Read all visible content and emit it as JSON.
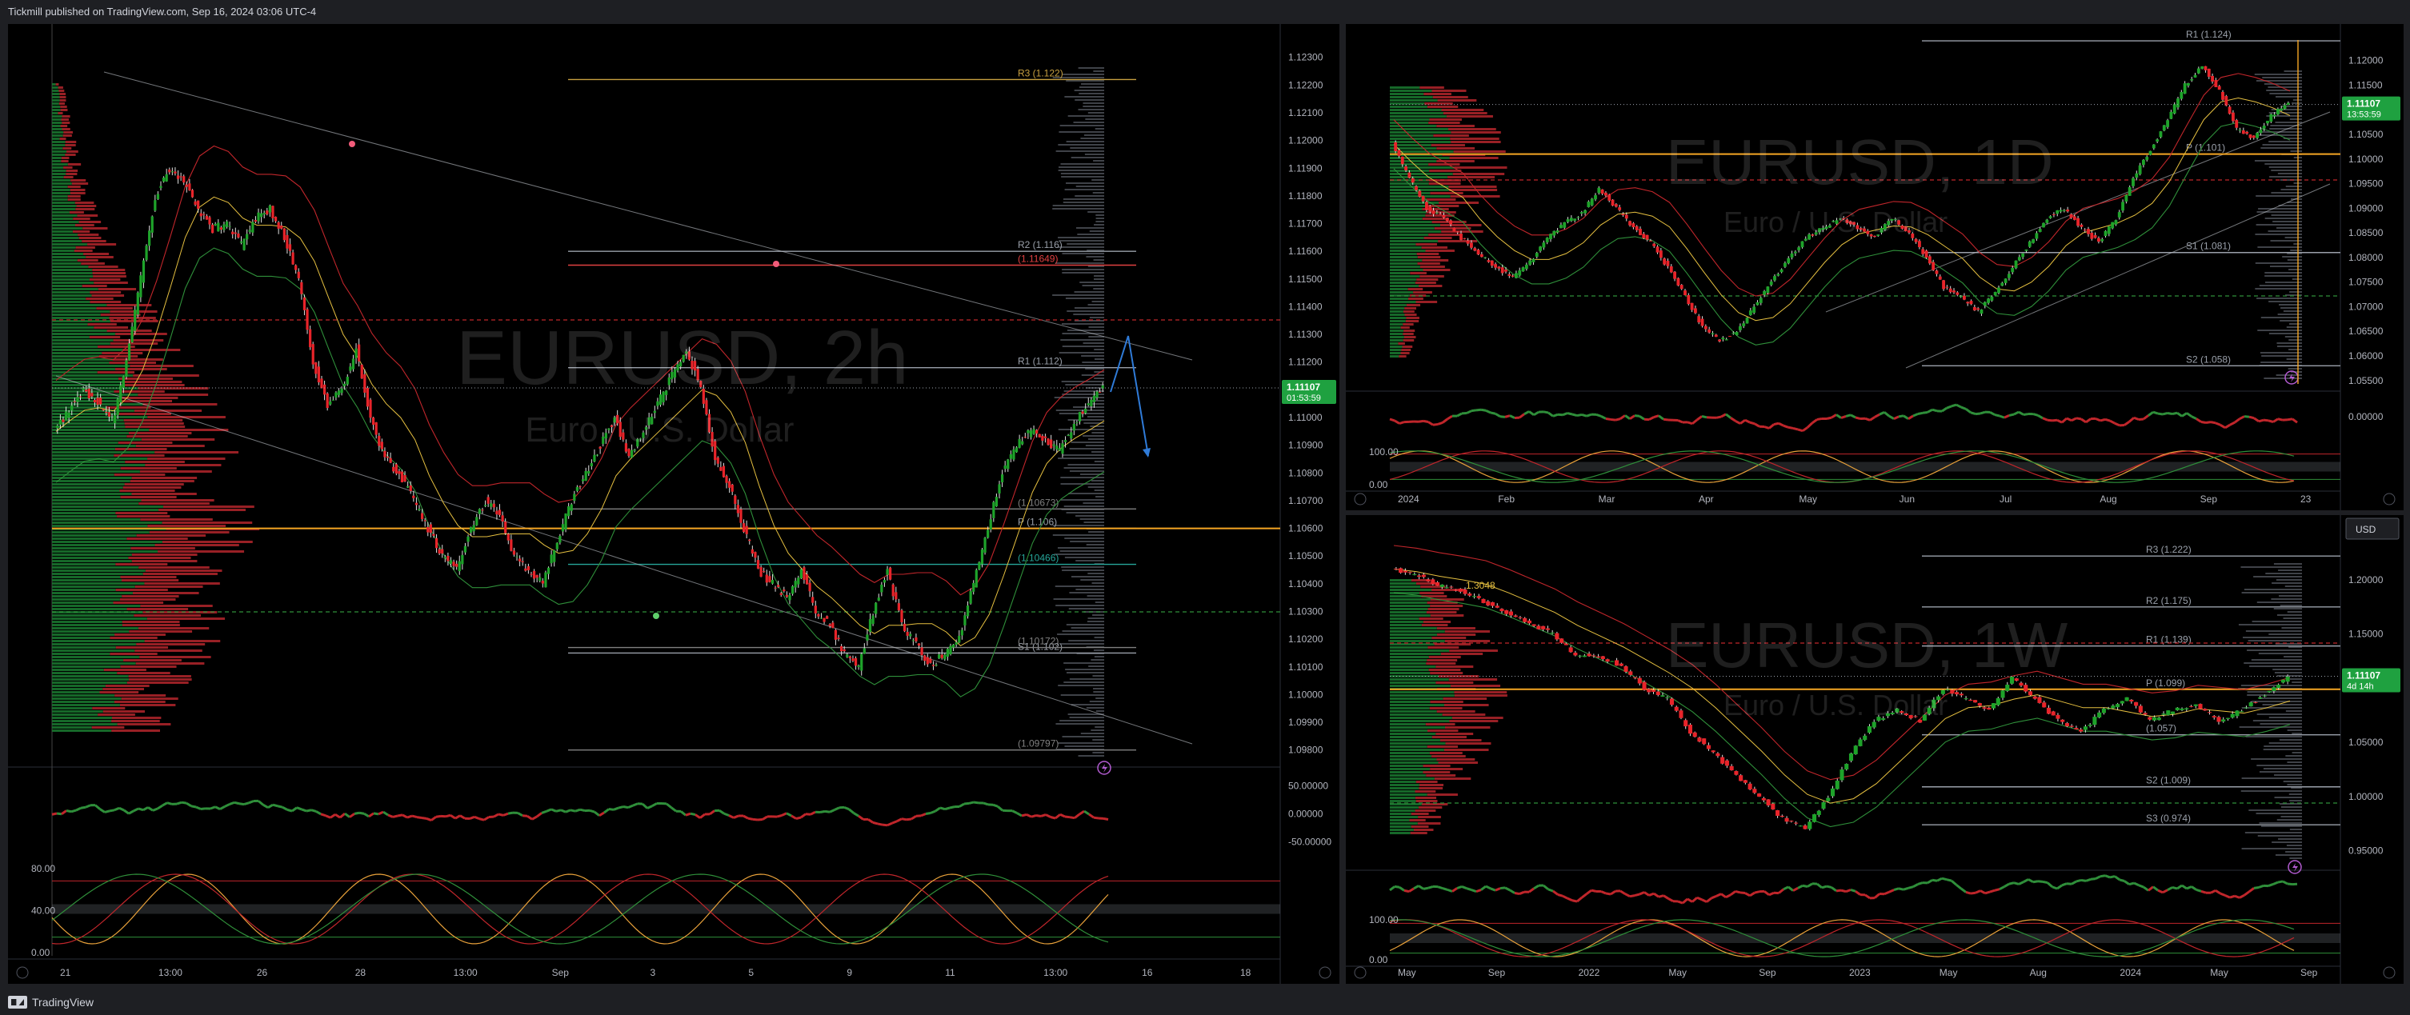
{
  "header": {
    "publish_line": "Tickmill published on TradingView.com, Sep 16, 2024 03:06 UTC-4"
  },
  "footer": {
    "brand": "TradingView"
  },
  "chart_data": [
    {
      "type": "candlestick",
      "symbol_watermark": "EURUSD, 2h",
      "subtitle_watermark": "Euro / U.S. Dollar",
      "ylim": [
        1.0975,
        1.1238
      ],
      "price_ticks": [
        "1.12300",
        "1.12200",
        "1.12100",
        "1.12000",
        "1.11900",
        "1.11800",
        "1.11700",
        "1.11600",
        "1.11500",
        "1.11400",
        "1.11300",
        "1.11200",
        "1.11000",
        "1.10900",
        "1.10800",
        "1.10700",
        "1.10600",
        "1.10500",
        "1.10400",
        "1.10300",
        "1.10200",
        "1.10100",
        "1.10000",
        "1.09900",
        "1.09800"
      ],
      "x_labels": [
        "21",
        "13:00",
        "26",
        "28",
        "13:00",
        "Sep",
        "3",
        "5",
        "9",
        "11",
        "13:00",
        "16",
        "18"
      ],
      "last_price": "1.11107",
      "countdown": "01:53:59",
      "close_path": [
        1.1095,
        1.1103,
        1.111,
        1.1106,
        1.1098,
        1.112,
        1.115,
        1.118,
        1.119,
        1.1185,
        1.1175,
        1.1168,
        1.117,
        1.1162,
        1.1172,
        1.1175,
        1.1165,
        1.115,
        1.112,
        1.1105,
        1.111,
        1.1125,
        1.11,
        1.1085,
        1.108,
        1.107,
        1.106,
        1.105,
        1.1045,
        1.106,
        1.107,
        1.1065,
        1.105,
        1.1045,
        1.104,
        1.1055,
        1.107,
        1.108,
        1.109,
        1.11,
        1.1085,
        1.1095,
        1.1105,
        1.1115,
        1.1125,
        1.111,
        1.1085,
        1.1075,
        1.106,
        1.1045,
        1.104,
        1.1035,
        1.1045,
        1.103,
        1.1025,
        1.1015,
        1.101,
        1.103,
        1.1045,
        1.1025,
        1.1018,
        1.101,
        1.1015,
        1.102,
        1.104,
        1.106,
        1.108,
        1.109,
        1.1095,
        1.1092,
        1.1088,
        1.1098,
        1.1105,
        1.1111
      ],
      "levels": [
        {
          "label": "R3 (1.122)",
          "price": 1.1222,
          "color": "#c8a040"
        },
        {
          "label": "R2 (1.116)",
          "price": 1.116,
          "color": "#9aa0aa"
        },
        {
          "label": "(1.11649)",
          "price": 1.1155,
          "color": "#e04040"
        },
        {
          "label": "R1 (1.112)",
          "price": 1.1118,
          "color": "#9aa0aa"
        },
        {
          "label": "(1.10673)",
          "price": 1.1067,
          "color": "#808080"
        },
        {
          "label": "P (1.106)",
          "price": 1.106,
          "color": "#9aa0aa"
        },
        {
          "label": "(1.10466)",
          "price": 1.1047,
          "color": "#26a69a"
        },
        {
          "label": "S1 (1.102)",
          "price": 1.1015,
          "color": "#9aa0aa"
        },
        {
          "label": "(1.10172)",
          "price": 1.1017,
          "color": "#808080"
        },
        {
          "label": "(1.09797)",
          "price": 1.098,
          "color": "#808080"
        }
      ],
      "oscillator_ticks": [
        "50.00000",
        "0.00000",
        "-50.00000"
      ],
      "stoch_ticks": [
        "80.00",
        "40.00",
        "0.00"
      ]
    },
    {
      "type": "candlestick",
      "symbol_watermark": "EURUSD, 1D",
      "subtitle_watermark": "Euro / U.S. Dollar",
      "ylim": [
        1.0535,
        1.1245
      ],
      "price_ticks": [
        "1.12000",
        "1.11500",
        "1.10500",
        "1.10000",
        "1.09500",
        "1.09000",
        "1.08500",
        "1.08000",
        "1.07500",
        "1.07000",
        "1.06500",
        "1.06000",
        "1.05500"
      ],
      "x_labels": [
        "2024",
        "Feb",
        "Mar",
        "Apr",
        "May",
        "Jun",
        "Jul",
        "Aug",
        "Sep",
        "23"
      ],
      "last_price": "1.11107",
      "countdown": "13:53:59",
      "close_path": [
        1.103,
        1.096,
        1.09,
        1.088,
        1.084,
        1.081,
        1.078,
        1.076,
        1.079,
        1.084,
        1.087,
        1.089,
        1.094,
        1.09,
        1.086,
        1.083,
        1.078,
        1.072,
        1.066,
        1.063,
        1.065,
        1.07,
        1.075,
        1.08,
        1.084,
        1.086,
        1.088,
        1.086,
        1.084,
        1.088,
        1.085,
        1.08,
        1.074,
        1.072,
        1.069,
        1.073,
        1.078,
        1.083,
        1.088,
        1.09,
        1.086,
        1.083,
        1.088,
        1.096,
        1.102,
        1.108,
        1.115,
        1.119,
        1.114,
        1.106,
        1.104,
        1.109,
        1.1111
      ],
      "levels": [
        {
          "label": "R1 (1.124)",
          "price": 1.124,
          "color": "#9aa0aa"
        },
        {
          "label": "P (1.101)",
          "price": 1.101,
          "color": "#9aa0aa"
        },
        {
          "label": "S1 (1.081)",
          "price": 1.081,
          "color": "#9aa0aa"
        },
        {
          "label": "S2 (1.058)",
          "price": 1.058,
          "color": "#9aa0aa"
        }
      ],
      "stoch_ticks": [
        "100.00",
        "0.00"
      ],
      "oscillator_ticks": [
        "0.00000"
      ]
    },
    {
      "type": "candlestick",
      "symbol_watermark": "EURUSD, 1W",
      "subtitle_watermark": "Euro / U.S. Dollar",
      "ylim": [
        0.935,
        1.245
      ],
      "price_ticks": [
        "1.20000",
        "1.15000",
        "1.05000",
        "1.00000",
        "0.95000"
      ],
      "x_labels": [
        "May",
        "Sep",
        "2022",
        "May",
        "Sep",
        "2023",
        "May",
        "Aug",
        "2024",
        "May",
        "Sep"
      ],
      "last_price": "1.11107",
      "countdown": "4d 14h",
      "currency": "USD",
      "close_path": [
        1.21,
        1.205,
        1.195,
        1.19,
        1.18,
        1.17,
        1.16,
        1.15,
        1.13,
        1.13,
        1.12,
        1.1,
        1.09,
        1.06,
        1.04,
        1.02,
        1.0,
        0.98,
        0.97,
        1.0,
        1.04,
        1.07,
        1.08,
        1.07,
        1.1,
        1.09,
        1.08,
        1.11,
        1.09,
        1.07,
        1.06,
        1.08,
        1.09,
        1.07,
        1.08,
        1.085,
        1.07,
        1.08,
        1.095,
        1.1111
      ],
      "levels": [
        {
          "label": "R3 (1.222)",
          "price": 1.222,
          "color": "#9aa0aa"
        },
        {
          "label": "R2 (1.175)",
          "price": 1.175,
          "color": "#9aa0aa"
        },
        {
          "label": "R1 (1.139)",
          "price": 1.139,
          "color": "#9aa0aa"
        },
        {
          "label": "P (1.099)",
          "price": 1.099,
          "color": "#9aa0aa"
        },
        {
          "label": "(1.057)",
          "price": 1.057,
          "color": "#9aa0aa"
        },
        {
          "label": "S2 (1.009)",
          "price": 1.009,
          "color": "#9aa0aa"
        },
        {
          "label": "S3 (0.974)",
          "price": 0.974,
          "color": "#9aa0aa"
        }
      ],
      "annotation": "1.3048",
      "stoch_ticks": [
        "100.00",
        "0.00"
      ]
    }
  ],
  "colors": {
    "up": "#1ea32a",
    "down": "#e8242a",
    "poc": "#f5a623",
    "axis_text": "#b2b5be",
    "price_tag": "#1fa140",
    "last_line": "#9aa0aa",
    "trend": "#c0c4cc",
    "arrow": "#2f7bd8"
  },
  "icons": [
    "lightning-icon",
    "chart-settings-icon",
    "z-icon",
    "a-icon",
    "tradingview-logo-icon"
  ]
}
